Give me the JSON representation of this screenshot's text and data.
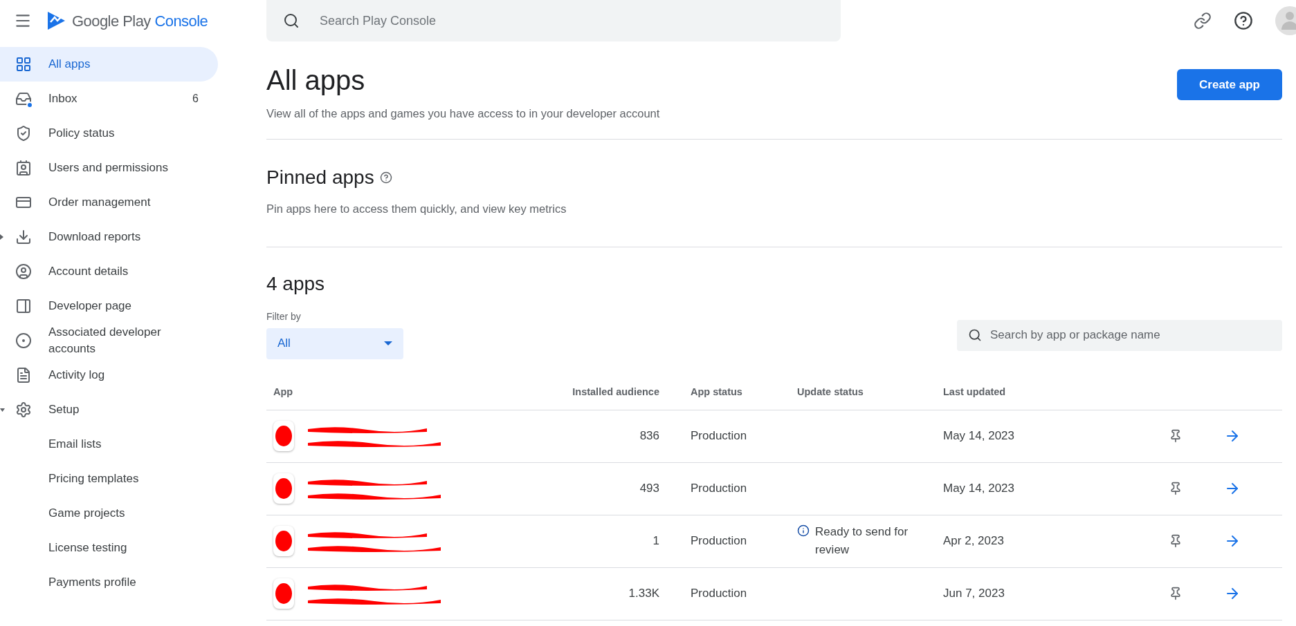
{
  "header": {
    "logo": {
      "word1": "Google Play",
      "word2": "Console"
    },
    "search": {
      "placeholder": "Search Play Console"
    }
  },
  "sidebar": {
    "items": [
      {
        "label": "All apps",
        "selected": true
      },
      {
        "label": "Inbox",
        "selected": false,
        "count": "6",
        "unread": true
      },
      {
        "label": "Policy status",
        "selected": false
      },
      {
        "label": "Users and permissions",
        "selected": false
      },
      {
        "label": "Order management",
        "selected": false
      },
      {
        "label": "Download reports",
        "selected": false,
        "expanded": false
      },
      {
        "label": "Account details",
        "selected": false
      },
      {
        "label": "Developer page",
        "selected": false
      },
      {
        "label": "Associated developer accounts",
        "selected": false
      },
      {
        "label": "Activity log",
        "selected": false
      },
      {
        "label": "Setup",
        "selected": false,
        "expanded": true,
        "children": [
          {
            "label": "Email lists",
            "selected": false
          },
          {
            "label": "Pricing templates",
            "selected": false
          },
          {
            "label": "Game projects",
            "selected": false
          },
          {
            "label": "License testing",
            "selected": false
          },
          {
            "label": "Payments profile",
            "selected": false
          }
        ]
      }
    ]
  },
  "page": {
    "title": "All apps",
    "subtitle": "View all of the apps and games you have access to in your developer account",
    "create_button": "Create app",
    "pinned": {
      "title": "Pinned apps",
      "description": "Pin apps here to access them quickly, and view key metrics"
    },
    "count_title": "4 apps",
    "filter": {
      "label": "Filter by",
      "value": "All"
    },
    "search": {
      "placeholder": "Search by app or package name"
    },
    "table": {
      "columns": [
        "App",
        "Installed audience",
        "App status",
        "Update status",
        "Last updated"
      ],
      "rows": [
        {
          "audience": "836",
          "status": "Production",
          "last_updated": "May 14, 2023"
        },
        {
          "audience": "493",
          "status": "Production",
          "last_updated": "May 14, 2023"
        },
        {
          "audience": "1",
          "status": "Production",
          "update_status": "Ready to send for review",
          "last_updated": "Apr 2, 2023"
        },
        {
          "audience": "1.33K",
          "status": "Production",
          "last_updated": "Jun 7, 2023"
        }
      ]
    }
  }
}
